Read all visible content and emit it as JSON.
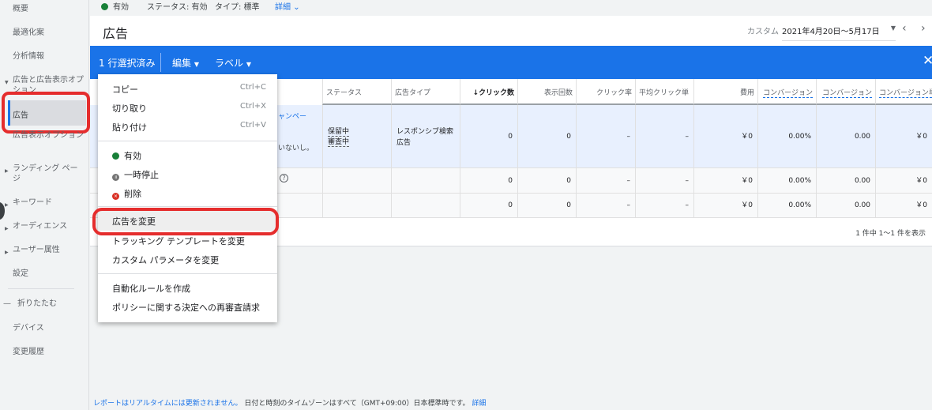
{
  "sidebar": {
    "items": [
      "概要",
      "最適化案",
      "分析情報",
      "広告と広告表示オプション",
      "広告",
      "広告表示オプション",
      "ランディング ページ",
      "キーワード",
      "オーディエンス",
      "ユーザー属性",
      "設定",
      "折りたたむ",
      "デバイス",
      "変更履歴"
    ]
  },
  "status_bar": {
    "status": "有効",
    "status_label": "ステータス: 有効",
    "type_label": "タイプ: 標準",
    "details": "詳細"
  },
  "header": {
    "title": "広告",
    "date_label": "カスタム",
    "date_range": "2021年4月20日～5月17日"
  },
  "action_bar": {
    "selected": "1 行選択済み",
    "edit": "編集",
    "label": "ラベル"
  },
  "table": {
    "headers": [
      "ステータス",
      "広告タイプ",
      "クリック数",
      "表示回数",
      "クリック率",
      "平均クリック単",
      "費用",
      "コンバージョン",
      "コンバージョン",
      "コンバージョン単"
    ],
    "row1_partial": [
      "ャンペー",
      "いないし。"
    ],
    "row1_status": [
      "保留中",
      "審査中"
    ],
    "row1_type": [
      "レスポンシブ検索",
      "広告"
    ],
    "rows": [
      [
        "0",
        "0",
        "–",
        "–",
        "￥0",
        "0.00%",
        "0.00",
        "￥0"
      ],
      [
        "0",
        "0",
        "–",
        "–",
        "￥0",
        "0.00%",
        "0.00",
        "￥0"
      ],
      [
        "0",
        "0",
        "–",
        "–",
        "￥0",
        "0.00%",
        "0.00",
        "￥0"
      ]
    ],
    "pagination": "1 件中 1～1 件を表示"
  },
  "menu": {
    "copy": "コピー",
    "copy_sc": "Ctrl+C",
    "cut": "切り取り",
    "cut_sc": "Ctrl+X",
    "paste": "貼り付け",
    "paste_sc": "Ctrl+V",
    "enable": "有効",
    "pause": "一時停止",
    "remove": "削除",
    "change_ads": "広告を変更",
    "tracking": "トラッキング テンプレートを変更",
    "custom_params": "カスタム パラメータを変更",
    "auto_rule": "自動化ルールを作成",
    "policy": "ポリシーに関する決定への再審査請求"
  },
  "footer": {
    "note": "レポートはリアルタイムには更新されません。",
    "timezone": "日付と時刻のタイムゾーンはすべて（GMT+09:00）日本標準時です。",
    "details": "詳細"
  },
  "colors": {
    "accent": "#1a73e8",
    "highlight": "#e52d2d",
    "green": "#188038"
  }
}
